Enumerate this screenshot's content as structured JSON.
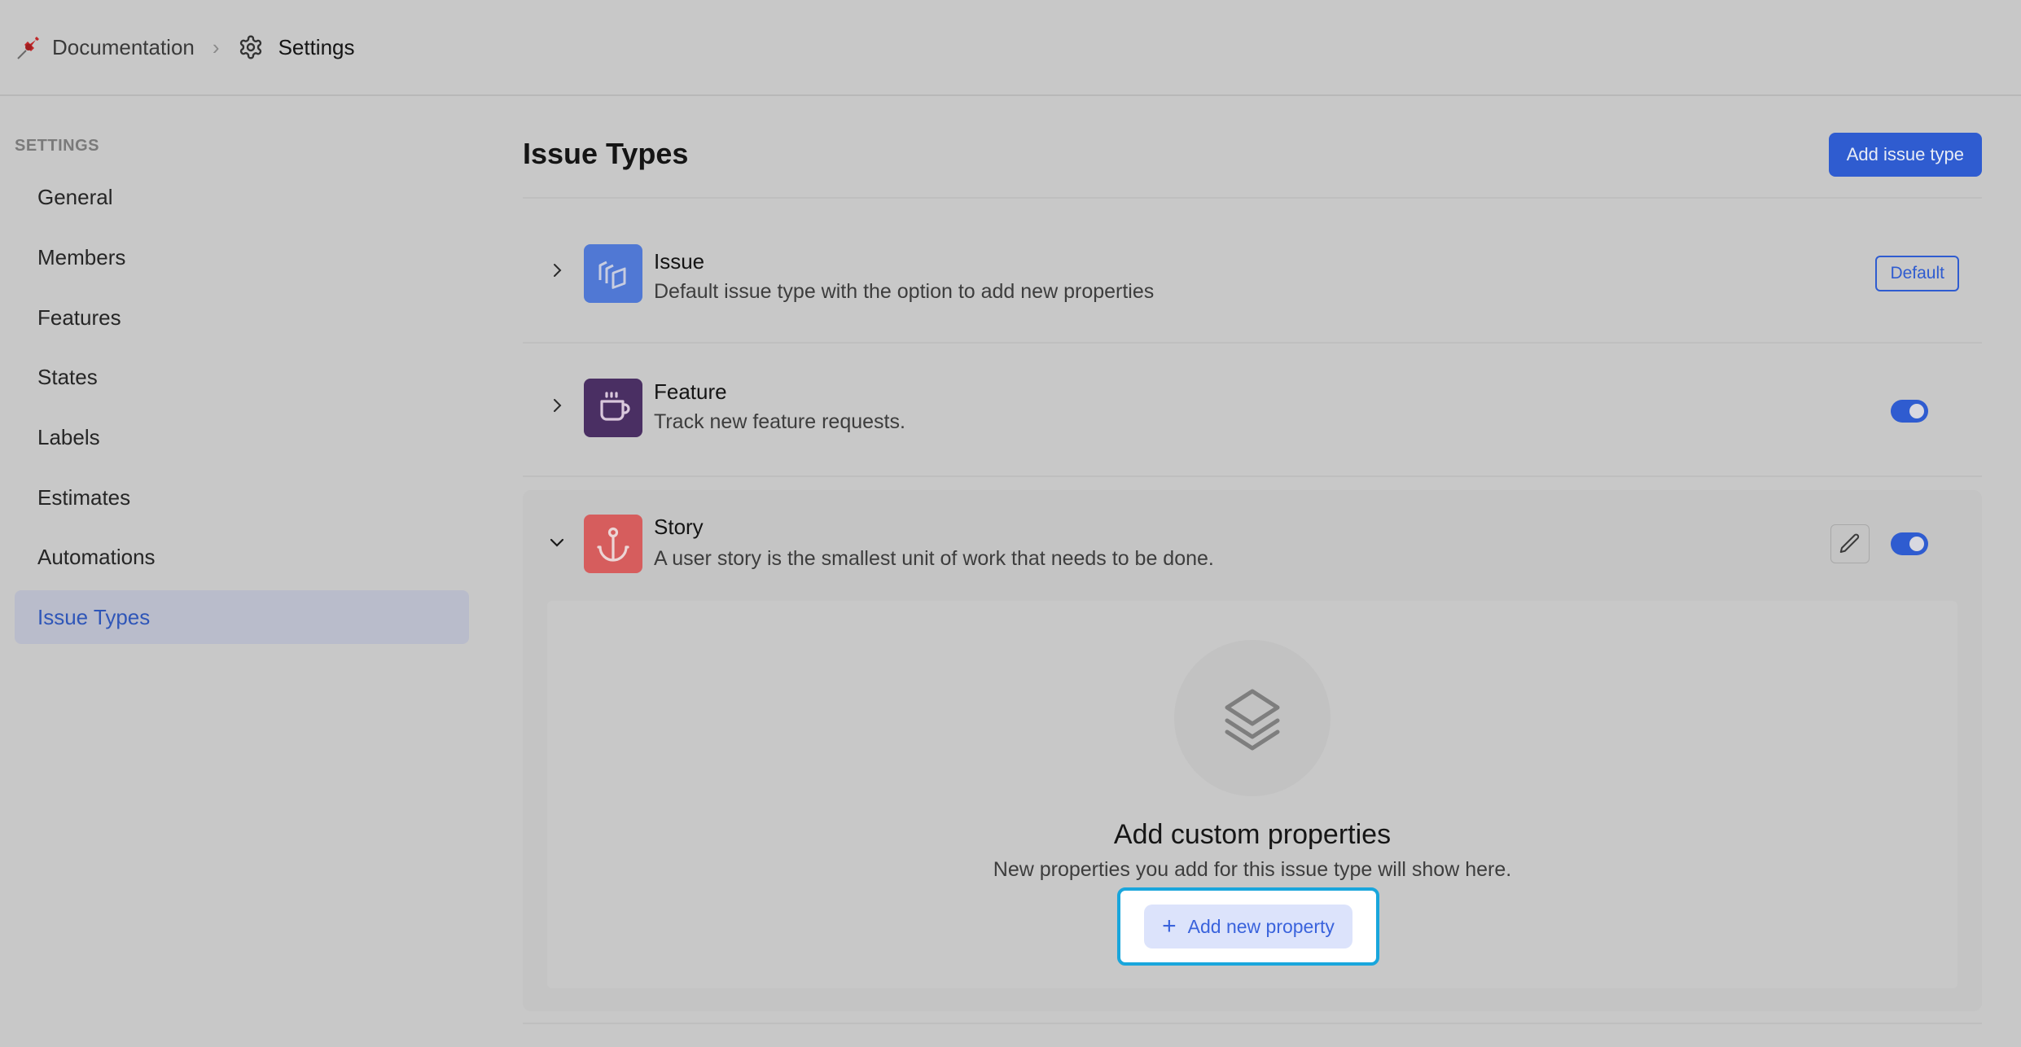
{
  "breadcrumb": {
    "project": "Documentation",
    "separator": "›",
    "current": "Settings"
  },
  "sidebar": {
    "heading": "SETTINGS",
    "items": [
      {
        "label": "General",
        "active": false
      },
      {
        "label": "Members",
        "active": false
      },
      {
        "label": "Features",
        "active": false
      },
      {
        "label": "States",
        "active": false
      },
      {
        "label": "Labels",
        "active": false
      },
      {
        "label": "Estimates",
        "active": false
      },
      {
        "label": "Automations",
        "active": false
      },
      {
        "label": "Issue Types",
        "active": true
      }
    ]
  },
  "main": {
    "title": "Issue Types",
    "add_button": "Add issue type",
    "issue_types": [
      {
        "name": "Issue",
        "description": "Default issue type with the option to add new properties",
        "icon": "layers-stack-icon",
        "icon_color": "#5078d4",
        "badge": "Default",
        "expanded": false
      },
      {
        "name": "Feature",
        "description": "Track new feature requests.",
        "icon": "coffee-cup-icon",
        "icon_color": "#4a2f63",
        "enabled": true,
        "expanded": false
      },
      {
        "name": "Story",
        "description": "A user story is the smallest unit of work that needs to be done.",
        "icon": "anchor-icon",
        "icon_color": "#d65d5d",
        "enabled": true,
        "expanded": true
      }
    ],
    "empty_properties": {
      "title": "Add custom properties",
      "subtitle": "New properties you add for this issue type will show here.",
      "button": "Add new property"
    }
  },
  "colors": {
    "accent": "#2f5cd0",
    "highlight": "#19a6dc",
    "active_nav_bg": "#b9bccb"
  }
}
